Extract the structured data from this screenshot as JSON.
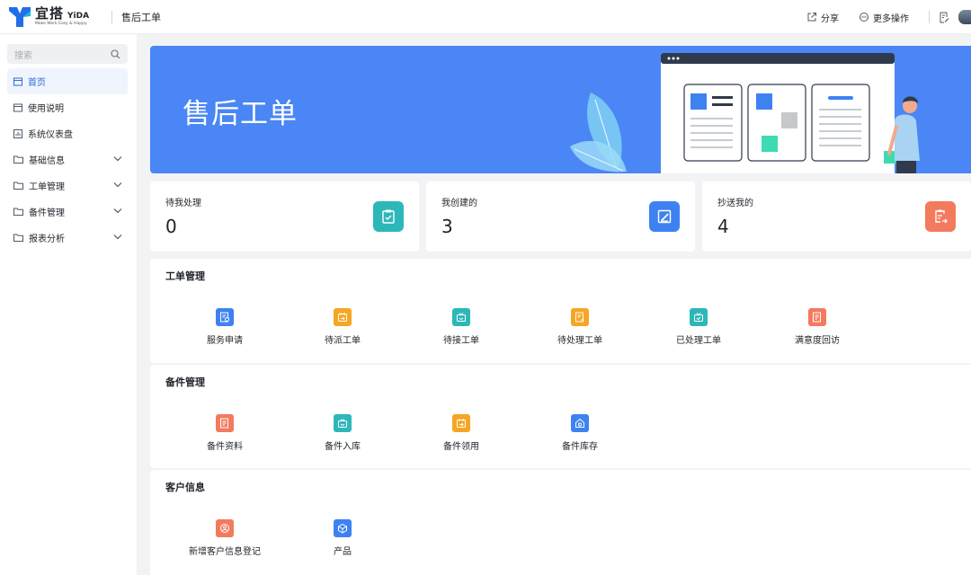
{
  "header": {
    "logo_cn": "宜搭",
    "logo_en": "YiDA",
    "logo_slogan": "Make Work Easy & Happy",
    "app_name": "售后工单",
    "share_label": "分享",
    "more_label": "更多操作"
  },
  "sidebar": {
    "search_placeholder": "搜索",
    "items": [
      {
        "label": "首页",
        "icon": "home-page-icon",
        "active": true,
        "expandable": false
      },
      {
        "label": "使用说明",
        "icon": "page-icon",
        "active": false,
        "expandable": false
      },
      {
        "label": "系统仪表盘",
        "icon": "dashboard-icon",
        "active": false,
        "expandable": false
      },
      {
        "label": "基础信息",
        "icon": "folder-icon",
        "active": false,
        "expandable": true
      },
      {
        "label": "工单管理",
        "icon": "folder-icon",
        "active": false,
        "expandable": true
      },
      {
        "label": "备件管理",
        "icon": "folder-icon",
        "active": false,
        "expandable": true
      },
      {
        "label": "报表分析",
        "icon": "folder-icon",
        "active": false,
        "expandable": true
      }
    ]
  },
  "banner": {
    "title": "售后工单"
  },
  "stats": [
    {
      "label": "待我处理",
      "value": "0",
      "icon": "clipboard-check-icon",
      "color": "#2db7b8"
    },
    {
      "label": "我创建的",
      "value": "3",
      "icon": "edit-doc-icon",
      "color": "#3d82f0"
    },
    {
      "label": "抄送我的",
      "value": "4",
      "icon": "cc-doc-icon",
      "color": "#f47a5e"
    }
  ],
  "sections": [
    {
      "title": "工单管理",
      "items": [
        {
          "label": "服务申请",
          "icon": "service-request-icon",
          "color": "#3d82f0"
        },
        {
          "label": "待派工单",
          "icon": "dispatch-icon",
          "color": "#f5a623"
        },
        {
          "label": "待接工单",
          "icon": "inbox-icon",
          "color": "#2db7b8"
        },
        {
          "label": "待处理工单",
          "icon": "pending-doc-icon",
          "color": "#f5a623"
        },
        {
          "label": "已处理工单",
          "icon": "done-box-icon",
          "color": "#2db7b8"
        },
        {
          "label": "满意度回访",
          "icon": "survey-icon",
          "color": "#f47a5e"
        }
      ]
    },
    {
      "title": "备件管理",
      "items": [
        {
          "label": "备件资料",
          "icon": "parts-doc-icon",
          "color": "#f47a5e"
        },
        {
          "label": "备件入库",
          "icon": "stock-in-icon",
          "color": "#2db7b8"
        },
        {
          "label": "备件领用",
          "icon": "parts-use-icon",
          "color": "#f5a623"
        },
        {
          "label": "备件库存",
          "icon": "warehouse-icon",
          "color": "#3d82f0"
        }
      ]
    },
    {
      "title": "客户信息",
      "items": [
        {
          "label": "新增客户信息登记",
          "icon": "customer-add-icon",
          "color": "#f47a5e"
        },
        {
          "label": "产品",
          "icon": "product-icon",
          "color": "#3d82f0"
        }
      ]
    }
  ],
  "colors": {
    "accent": "#2e6ad8",
    "banner": "#4a86f5"
  }
}
